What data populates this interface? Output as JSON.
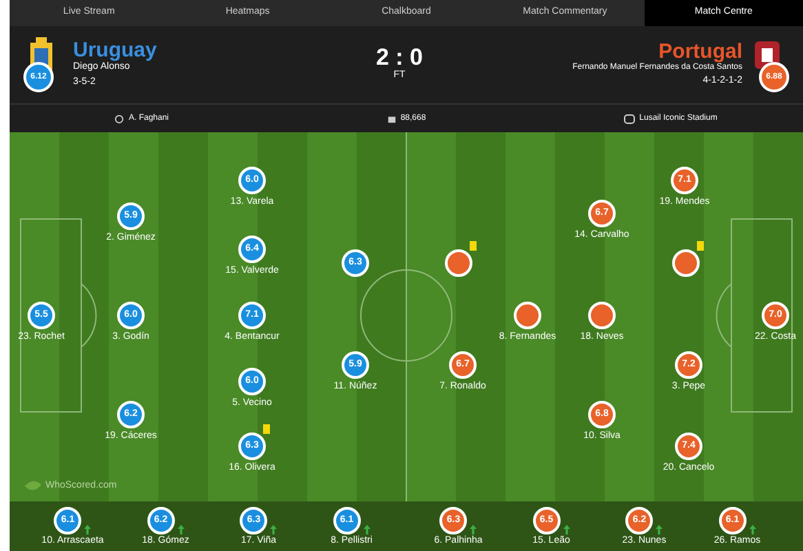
{
  "tabs": [
    {
      "label": "Live Stream",
      "selected": false
    },
    {
      "label": "Heatmaps",
      "selected": false
    },
    {
      "label": "Chalkboard",
      "selected": false
    },
    {
      "label": "Match Commentary",
      "selected": false
    },
    {
      "label": "Match Centre",
      "selected": true
    }
  ],
  "home": {
    "name": "Uruguay",
    "manager": "Diego Alonso",
    "formation": "3-5-2",
    "rating": "6.12"
  },
  "away": {
    "name": "Portugal",
    "manager": "Fernando Manuel Fernandes da Costa Santos",
    "formation": "4-1-2-1-2",
    "rating": "6.88"
  },
  "score": "2 : 0",
  "status": "FT",
  "info": {
    "referee": "A. Faghani",
    "attendance": "88,668",
    "venue": "Lusail Iconic Stadium"
  },
  "home_players": [
    {
      "rating": "6.0",
      "name": "13. Varela",
      "yellow_card": false
    },
    {
      "rating": "5.9",
      "name": "2. Giménez",
      "yellow_card": false
    },
    {
      "rating": "6.4",
      "name": "15. Valverde",
      "yellow_card": false
    },
    {
      "rating": "6.3",
      "yellow_card": false
    },
    {
      "rating": "5.5",
      "name": "23. Rochet",
      "yellow_card": false
    },
    {
      "rating": "6.0",
      "name": "3. Godín",
      "yellow_card": false
    },
    {
      "rating": "7.1",
      "name": "4. Bentancur",
      "yellow_card": false
    },
    {
      "rating": "5.9",
      "name": "11. Núñez",
      "yellow_card": false
    },
    {
      "rating": "6.0",
      "name": "5. Vecino",
      "yellow_card": false
    },
    {
      "rating": "6.2",
      "name": "19. Cáceres",
      "yellow_card": false
    },
    {
      "rating": "6.3",
      "name": "16. Olivera",
      "yellow_card": true
    }
  ],
  "away_players": [
    {
      "rating": "7.1",
      "name": "19. Mendes",
      "yellow_card": false
    },
    {
      "rating": "6.7",
      "name": "14. Carvalho",
      "yellow_card": false
    },
    {
      "yellow_card": true
    },
    {
      "yellow_card": true
    },
    {
      "name": "8. Fernandes",
      "yellow_card": false
    },
    {
      "name": "18. Neves",
      "yellow_card": false
    },
    {
      "rating": "7.0",
      "name": "22. Costa",
      "yellow_card": false
    },
    {
      "rating": "6.7",
      "name": "7. Ronaldo",
      "yellow_card": false
    },
    {
      "rating": "7.2",
      "name": "3. Pepe",
      "yellow_card": false
    },
    {
      "rating": "6.8",
      "name": "10. Silva",
      "yellow_card": false
    },
    {
      "rating": "7.4",
      "name": "20. Cancelo",
      "yellow_card": false
    }
  ],
  "pitch_logo": "WhoScored.com",
  "home_subs": [
    {
      "rating": "6.1",
      "name": "10. Arrascaeta"
    },
    {
      "rating": "6.2",
      "name": "18. Gómez"
    },
    {
      "rating": "6.3",
      "name": "17. Viña"
    },
    {
      "rating": "6.1",
      "name": "8. Pellistri"
    }
  ],
  "away_subs": [
    {
      "rating": "6.3",
      "name": "6. Palhinha"
    },
    {
      "rating": "6.5",
      "name": "15. Leão"
    },
    {
      "rating": "6.2",
      "name": "23. Nunes"
    },
    {
      "rating": "6.1",
      "name": "26. Ramos"
    }
  ]
}
